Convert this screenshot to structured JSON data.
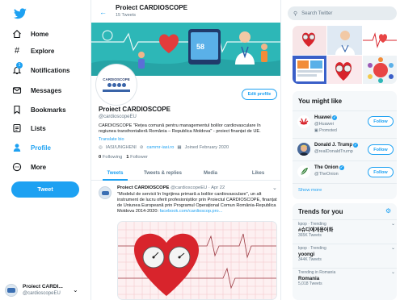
{
  "nav": {
    "items": [
      {
        "label": "Home",
        "icon": "home-icon"
      },
      {
        "label": "Explore",
        "icon": "hashtag-icon"
      },
      {
        "label": "Notifications",
        "icon": "bell-icon",
        "badge": "1"
      },
      {
        "label": "Messages",
        "icon": "envelope-icon"
      },
      {
        "label": "Bookmarks",
        "icon": "bookmark-icon"
      },
      {
        "label": "Lists",
        "icon": "list-icon"
      },
      {
        "label": "Profile",
        "icon": "person-icon",
        "active": true
      },
      {
        "label": "More",
        "icon": "more-icon"
      }
    ],
    "tweet_button": "Tweet",
    "account": {
      "name": "Proiect CARDI...",
      "handle": "@cardioscopeEU"
    }
  },
  "header": {
    "title": "Proiect CARDIOSCOPE",
    "subtitle": "15 Tweets"
  },
  "profile": {
    "name": "Proiect CARDIOSCOPE",
    "handle": "@cardioscopeEU",
    "bio": "CARDIOSCOPE \"Rețea comună pentru managementul bolilor cardiovasculare în regiunea transfrontalieră România – Republica Moldova\" - proiect finanțat de UE.",
    "translate": "Translate bio",
    "location": "IASI/UNGHENI",
    "website": "cammr-iasi.ro",
    "joined": "Joined February 2020",
    "following_count": "0",
    "following_label": "Following",
    "followers_count": "1",
    "followers_label": "Follower",
    "edit_button": "Edit profile",
    "avatar_text": "CARDIOSCOPE",
    "banner_screen_text": "58"
  },
  "tabs": [
    "Tweets",
    "Tweets & replies",
    "Media",
    "Likes"
  ],
  "tweet": {
    "author": "Proiect CARDIOSCOPE",
    "handle": "@cardioscopeEU",
    "date": "Apr 22",
    "text": "\"Modelul de servicii în îngrijirea primară a bolilor cardiovasculare\", un alt instrument de lucru oferit profesioniștilor prin Proiectul CARDIOSCOPE, finanțat de Uniunea Europeană prin Programul Operațional Comun România-Republica Moldova 2014-2020:",
    "link": "facebook.com/cardioscop.pro..."
  },
  "search": {
    "placeholder": "Search Twitter"
  },
  "who_to_follow": {
    "title": "You might like",
    "users": [
      {
        "name": "Huawei",
        "handle": "@Huawei",
        "promoted": "Promoted",
        "follow": "Follow"
      },
      {
        "name": "Donald J. Trump",
        "handle": "@realDonaldTrump",
        "follow": "Follow"
      },
      {
        "name": "The Onion",
        "handle": "@TheOnion",
        "follow": "Follow"
      }
    ],
    "show_more": "Show more"
  },
  "trends": {
    "title": "Trends for you",
    "items": [
      {
        "meta": "kpop · Trending",
        "name": "#슈디에게용어화",
        "count": "365K Tweets"
      },
      {
        "meta": "kpop · Trending",
        "name": "yoongi",
        "count": "344K Tweets"
      },
      {
        "meta": "Trending in Romania",
        "name": "Romania",
        "count": "5,018 Tweets"
      }
    ]
  },
  "colors": {
    "accent": "#1da1f2",
    "banner": "#2bb5b5",
    "heart": "#d8242c"
  }
}
